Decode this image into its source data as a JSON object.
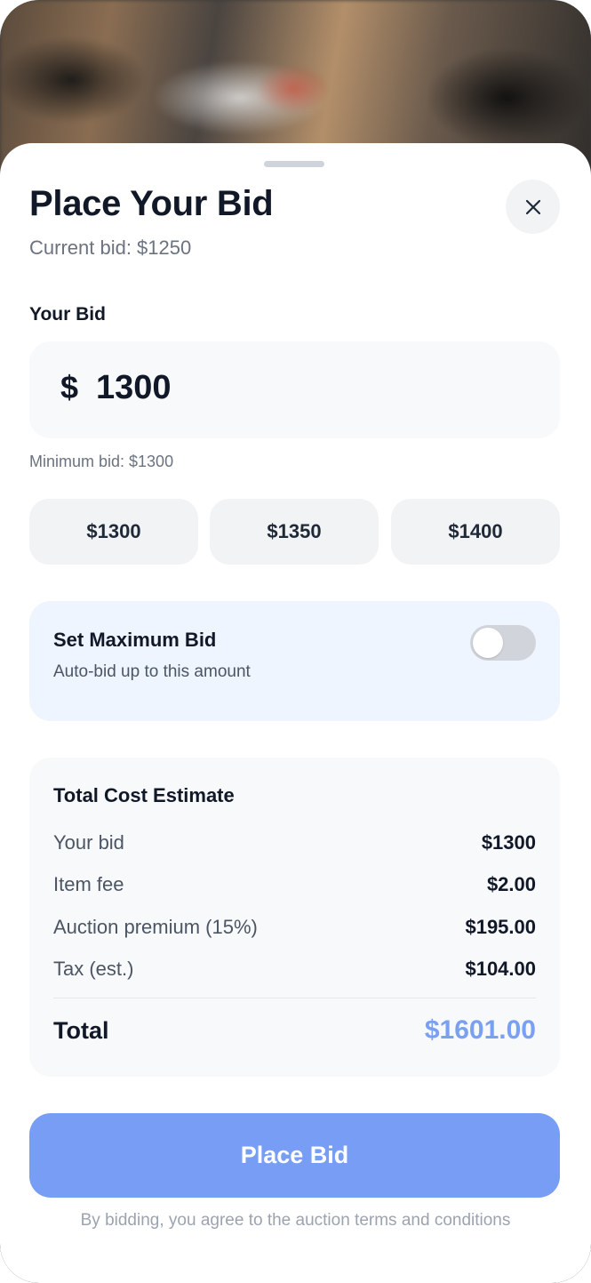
{
  "sheet": {
    "title": "Place Your Bid",
    "current_bid": "Current bid: $1250",
    "close_icon": "close-icon"
  },
  "bid": {
    "label": "Your Bid",
    "currency_symbol": "$",
    "value": "1300",
    "minimum_text": "Minimum bid: $1300",
    "quick_options": [
      "$1300",
      "$1350",
      "$1400"
    ]
  },
  "max_bid": {
    "title": "Set Maximum Bid",
    "subtitle": "Auto-bid up to this amount",
    "toggle_on": false
  },
  "cost": {
    "title": "Total Cost Estimate",
    "rows": [
      {
        "label": "Your bid",
        "value": "$1300"
      },
      {
        "label": "Item fee",
        "value": "$2.00"
      },
      {
        "label": "Auction premium (15%)",
        "value": "$195.00"
      },
      {
        "label": "Tax (est.)",
        "value": "$104.00"
      }
    ],
    "total_label": "Total",
    "total_value": "$1601.00"
  },
  "actions": {
    "place_bid_label": "Place Bid",
    "terms_text": "By bidding, you agree to the auction terms and conditions"
  },
  "colors": {
    "accent": "#789df5",
    "total_accent": "#7aa0f2",
    "max_card_bg": "#eef5fe"
  }
}
